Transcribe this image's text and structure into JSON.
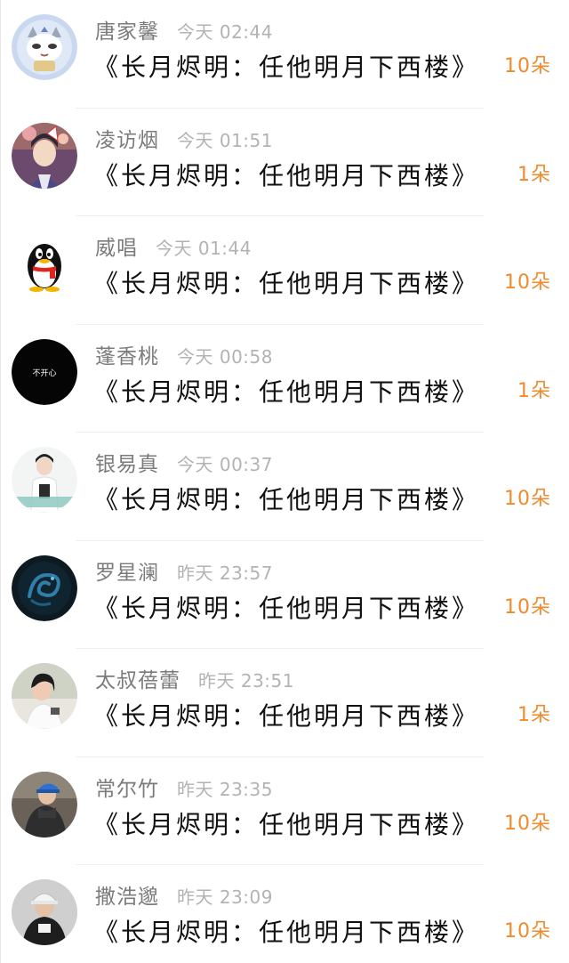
{
  "rows": [
    {
      "name": "唐家馨",
      "time": "今天 02:44",
      "title": "《长月烬明：任他明月下西楼》",
      "count": "10朵",
      "avatar": "cat-mask-avatar-icon"
    },
    {
      "name": "凌访烟",
      "time": "今天 01:51",
      "title": "《长月烬明：任他明月下西楼》",
      "count": "1朵",
      "avatar": "girl-fox-mask-avatar-icon"
    },
    {
      "name": "威唱",
      "time": "今天 01:44",
      "title": "《长月烬明：任他明月下西楼》",
      "count": "10朵",
      "avatar": "qq-penguin-avatar-icon"
    },
    {
      "name": "蓬香桃",
      "time": "今天 00:58",
      "title": "《长月烬明：任他明月下西楼》",
      "count": "1朵",
      "avatar": "black-text-avatar-icon",
      "avatar_text": "不开心"
    },
    {
      "name": "银易真",
      "time": "今天 00:37",
      "title": "《长月烬明：任他明月下西楼》",
      "count": "10朵",
      "avatar": "girl-white-shirt-avatar-icon"
    },
    {
      "name": "罗星澜",
      "time": "昨天 23:57",
      "title": "《长月烬明：任他明月下西楼》",
      "count": "10朵",
      "avatar": "blue-dragon-avatar-icon"
    },
    {
      "name": "太叔蓓蕾",
      "time": "昨天 23:51",
      "title": "《长月烬明：任他明月下西楼》",
      "count": "1朵",
      "avatar": "girl-photo-avatar-icon"
    },
    {
      "name": "常尔竹",
      "time": "昨天 23:35",
      "title": "《长月烬明：任他明月下西楼》",
      "count": "10朵",
      "avatar": "person-blue-cap-avatar-icon"
    },
    {
      "name": "撒浩邈",
      "time": "昨天 23:09",
      "title": "《长月烬明：任他明月下西楼》",
      "count": "10朵",
      "avatar": "person-white-cap-avatar-icon"
    }
  ],
  "colors": {
    "accent": "#f08a2c",
    "name": "#7b7b7b",
    "time": "#b3b3b3",
    "title": "#111111"
  }
}
